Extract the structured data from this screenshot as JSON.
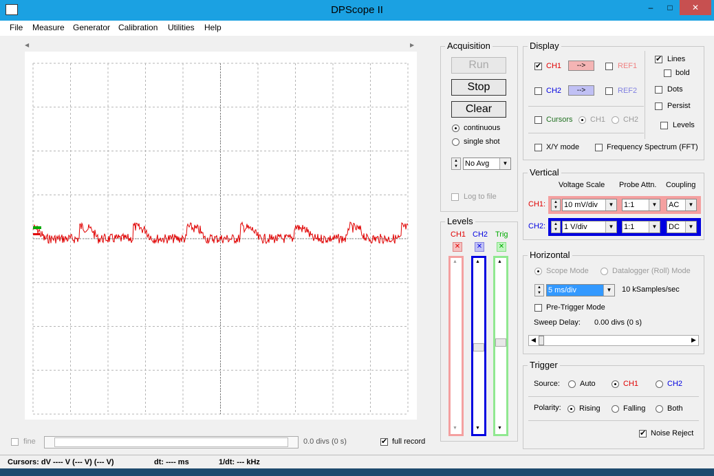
{
  "window": {
    "title": "DPScope II",
    "minimize": "–",
    "maximize": "□",
    "close": "✕"
  },
  "menu": [
    "File",
    "Measure",
    "Generator",
    "Calibration",
    "Utilities",
    "Help"
  ],
  "acquisition": {
    "title": "Acquisition",
    "run_label": "Run",
    "stop_label": "Stop",
    "clear_label": "Clear",
    "continuous_label": "continuous",
    "single_shot_label": "single shot",
    "avg_value": "No Avg",
    "log_label": "Log to file"
  },
  "levels": {
    "title": "Levels",
    "ch1": "CH1",
    "ch2": "CH2",
    "trig": "Trig",
    "close_glyph": "✕"
  },
  "display": {
    "title": "Display",
    "ch1_label": "CH1",
    "ch2_label": "CH2",
    "arrow": "-->",
    "ref1_label": "REF1",
    "ref2_label": "REF2",
    "lines_label": "Lines",
    "bold_label": "bold",
    "dots_label": "Dots",
    "persist_label": "Persist",
    "cursors_label": "Cursors",
    "cursor_ch1": "CH1",
    "cursor_ch2": "CH2",
    "levels_label": "Levels",
    "xy_label": "X/Y mode",
    "fft_label": "Frequency Spectrum (FFT)"
  },
  "vertical": {
    "title": "Vertical",
    "h_scale": "Voltage Scale",
    "h_probe": "Probe Attn.",
    "h_coupling": "Coupling",
    "ch1_label": "CH1:",
    "ch1_scale": "10 mV/div",
    "ch1_probe": "1:1",
    "ch1_coupling": "AC",
    "ch2_label": "CH2:",
    "ch2_scale": "1 V/div",
    "ch2_probe": "1:1",
    "ch2_coupling": "DC"
  },
  "horizontal": {
    "title": "Horizontal",
    "scope_mode": "Scope Mode",
    "datalogger_mode": "Datalogger (Roll) Mode",
    "timebase": "5 ms/div",
    "samplerate": "10 kSamples/sec",
    "pretrigger_label": "Pre-Trigger Mode",
    "sweep_delay_label": "Sweep Delay:",
    "sweep_delay_value": "0.00 divs (0 s)"
  },
  "trigger": {
    "title": "Trigger",
    "source_label": "Source:",
    "auto_label": "Auto",
    "ch1_label": "CH1",
    "ch2_label": "CH2",
    "polarity_label": "Polarity:",
    "rising_label": "Rising",
    "falling_label": "Falling",
    "both_label": "Both",
    "noise_reject_label": "Noise Reject"
  },
  "scope_bottom": {
    "fine_label": "fine",
    "pos_value": "0.0 divs (0 s)",
    "full_record_label": "full record"
  },
  "status": {
    "cursors": "Cursors:  dV  ---- V  (--- V) (--- V)",
    "dt": "dt:  ---- ms",
    "inv_dt": "1/dt:  --- kHz"
  },
  "colors": {
    "ch1": "#e00000",
    "ch2": "#0000e0",
    "trig": "#00aa00",
    "titlebar": "#1ba1e2"
  }
}
